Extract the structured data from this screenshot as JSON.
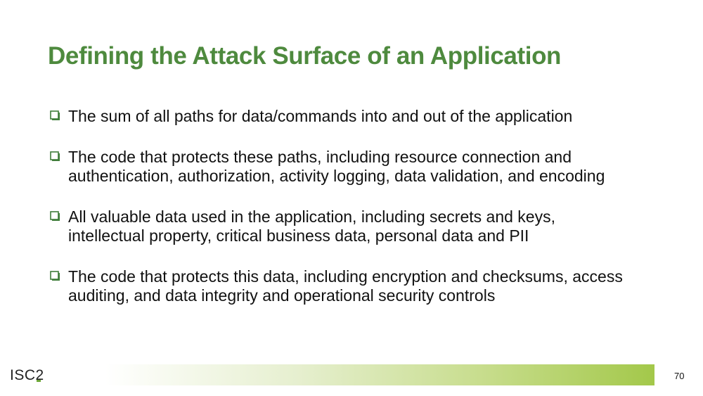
{
  "slide": {
    "title": "Defining the Attack Surface of an Application",
    "bullets": [
      "The sum of all paths for data/commands into and out of the application",
      "The code that protects these paths, including resource connection and authentication, authorization, activity logging, data validation, and encoding",
      "All valuable data used in the application, including secrets and keys, intellectual property, critical business data, personal data and PII",
      "The code that protects this data, including encryption and checksums, access auditing, and data integrity and operational security controls"
    ],
    "bullet_icon": "checkbox-square-icon"
  },
  "footer": {
    "logo_text": "ISC2",
    "page_number": "70"
  },
  "colors": {
    "title": "#4e8a3e",
    "bullet_icon": "#3f7d3a",
    "footer_gradient_end": "#a3c84a",
    "logo_accent": "#6fa83a"
  }
}
